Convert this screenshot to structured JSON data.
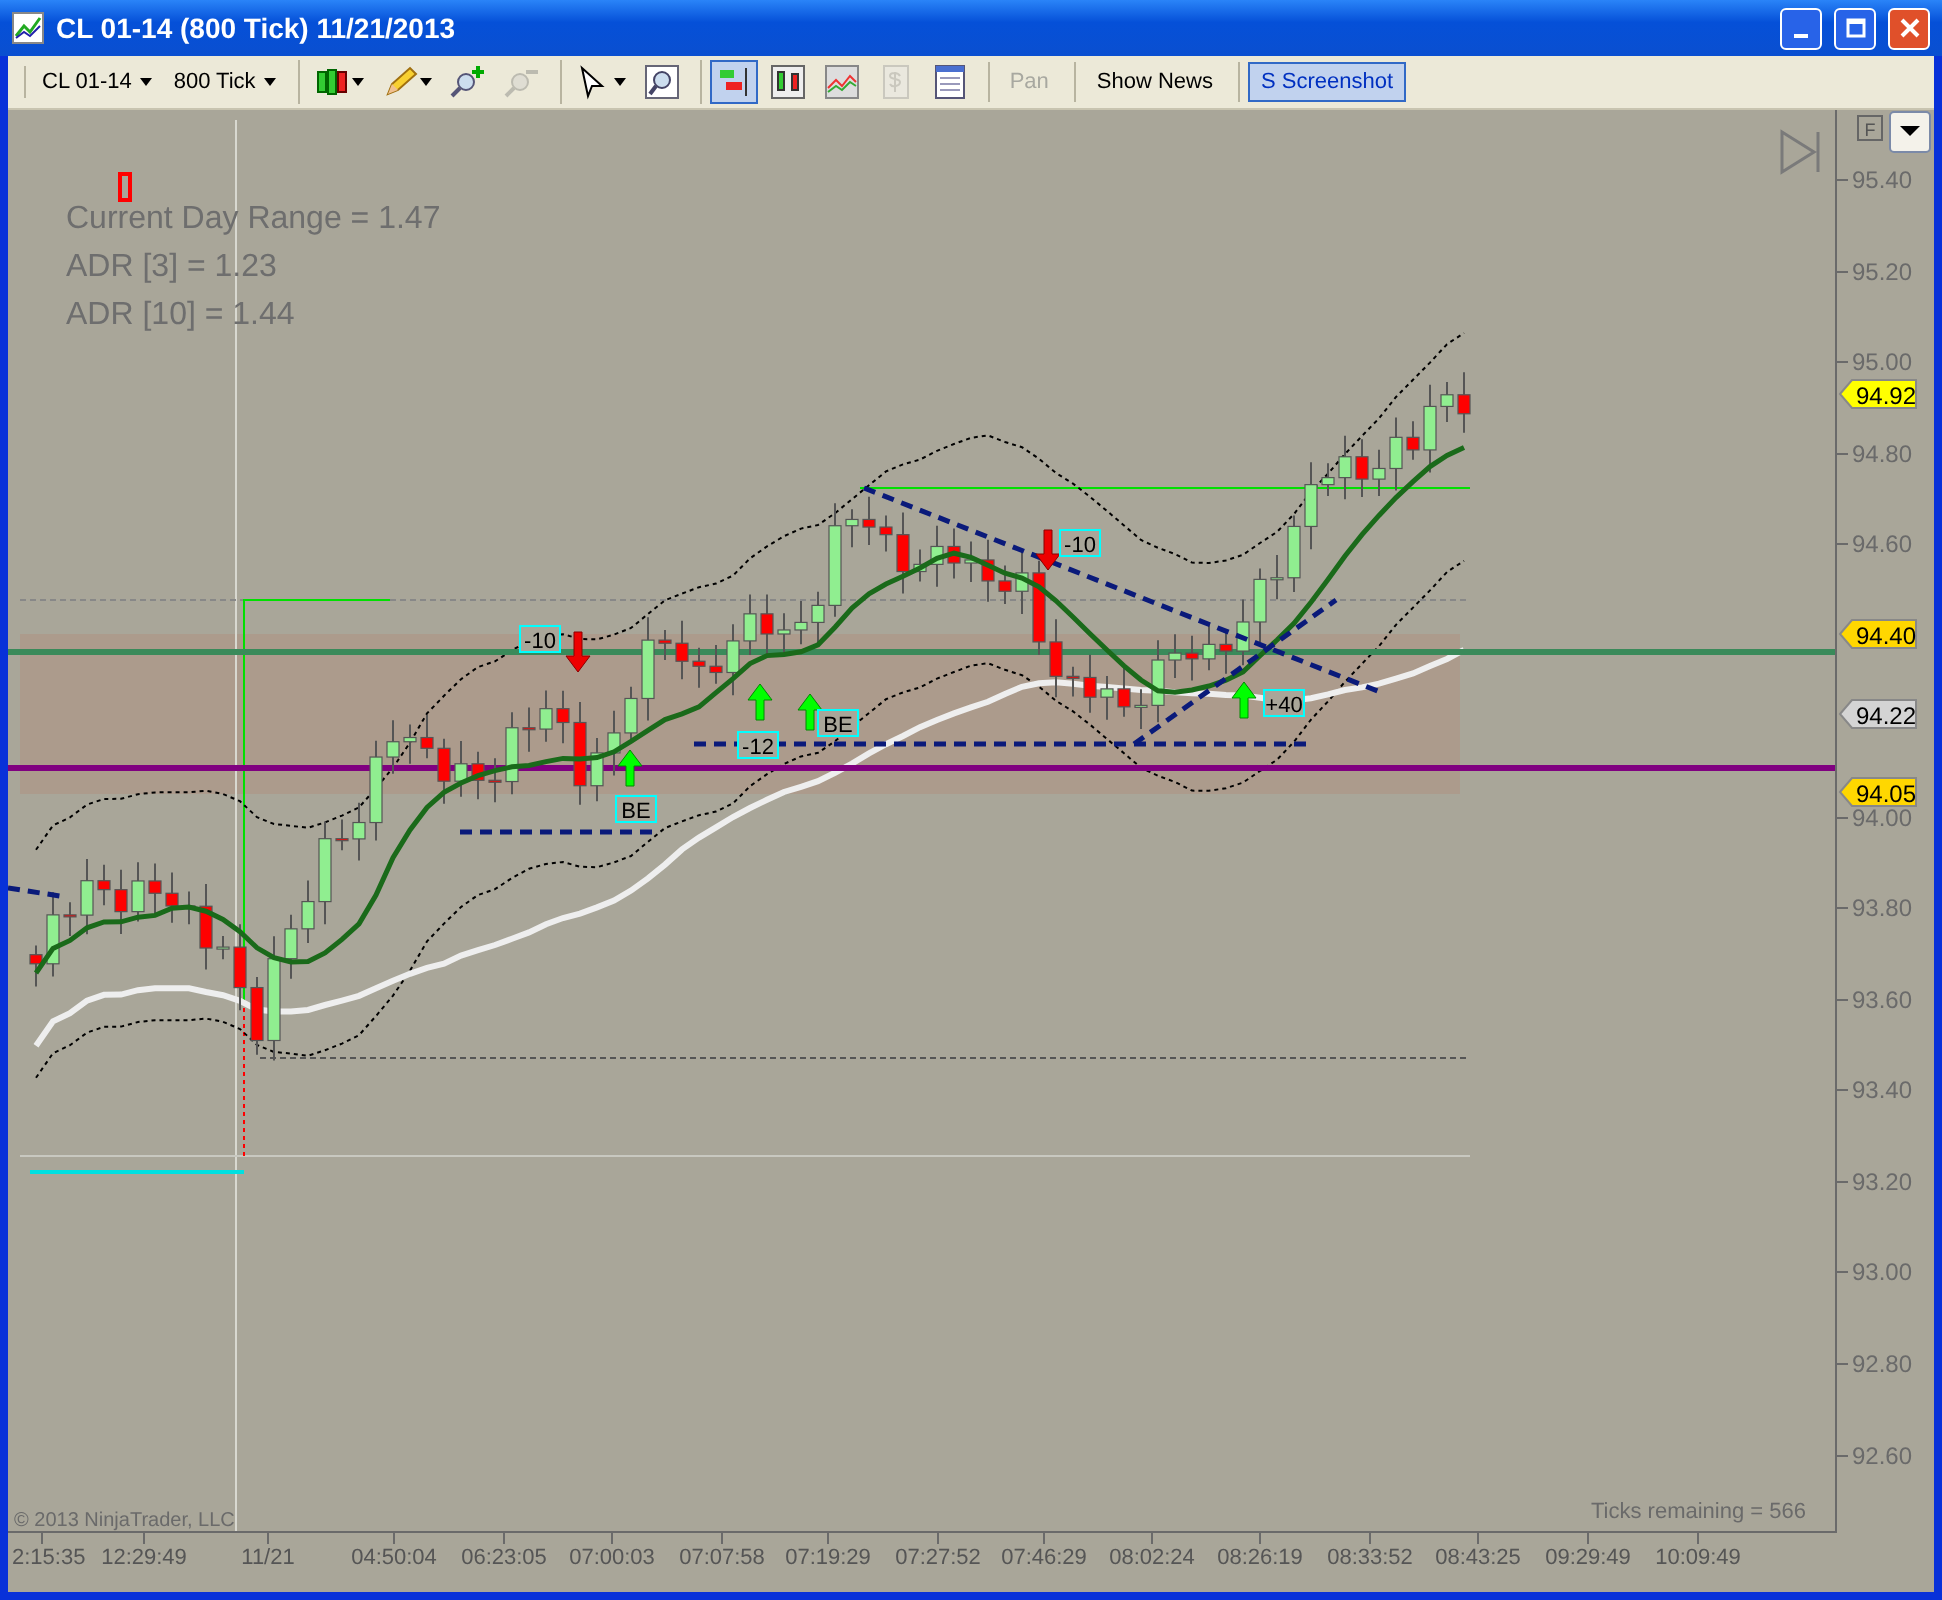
{
  "window": {
    "title": "CL 01-14 (800 Tick)  11/21/2013"
  },
  "toolbar": {
    "groups": [
      [
        {
          "kind": "dropdown",
          "label": "CL 01-14"
        },
        {
          "kind": "dropdown",
          "label": "800 Tick"
        }
      ],
      [
        {
          "kind": "candles-menu",
          "disabled": false,
          "selected": false
        },
        {
          "kind": "pencil-menu",
          "disabled": false,
          "selected": false
        },
        {
          "kind": "zoom-in",
          "disabled": false,
          "selected": false
        },
        {
          "kind": "zoom-out",
          "disabled": true,
          "selected": false
        }
      ],
      [
        {
          "kind": "pointer-menu",
          "disabled": false,
          "selected": false
        },
        {
          "kind": "magnifier",
          "disabled": false,
          "selected": false
        }
      ],
      [
        {
          "kind": "bars-toggle",
          "disabled": false,
          "selected": true
        },
        {
          "kind": "candles-toggle",
          "disabled": false,
          "selected": false
        },
        {
          "kind": "area-chart",
          "disabled": false,
          "selected": false
        },
        {
          "kind": "dollar",
          "disabled": true,
          "selected": false
        },
        {
          "kind": "properties",
          "disabled": false,
          "selected": false
        }
      ],
      [
        {
          "kind": "text-button",
          "label": "Pan",
          "disabled": true,
          "selected": false
        }
      ],
      [
        {
          "kind": "text-button",
          "label": "Show News",
          "disabled": false,
          "selected": false
        }
      ],
      [
        {
          "kind": "text-button",
          "label": "S Screenshot",
          "disabled": false,
          "selected": true
        }
      ]
    ]
  },
  "chart": {
    "info_lines": [
      "Current Day Range = 1.47",
      "ADR [3] = 1.23",
      "ADR [10] = 1.44"
    ],
    "axis_box_label": "F",
    "y_ticks": [
      "95.40",
      "95.20",
      "95.00",
      "94.80",
      "94.60",
      "94.00",
      "93.80",
      "93.60",
      "93.40",
      "93.20",
      "93.00",
      "92.80",
      "92.60"
    ],
    "price_markers": [
      {
        "label": "94.92",
        "color": "#ffff00"
      },
      {
        "label": "94.40",
        "color": "#ffd700"
      },
      {
        "label": "94.22",
        "color": "#d4d4d4"
      },
      {
        "label": "94.05",
        "color": "#ffd700"
      }
    ],
    "trade_labels": [
      "-10",
      "BE",
      "-12",
      "BE",
      "-10",
      "+40"
    ],
    "x_ticks": [
      "2:15:35",
      "12:29:49",
      "11/21",
      "04:50:04",
      "06:23:05",
      "07:00:03",
      "07:07:58",
      "07:19:29",
      "07:27:52",
      "07:46:29",
      "08:02:24",
      "08:26:19",
      "08:33:52",
      "08:43:25",
      "09:29:49",
      "10:09:49"
    ],
    "copyright": "© 2013 NinjaTrader, LLC",
    "ticks_remaining": "Ticks remaining = 566"
  }
}
